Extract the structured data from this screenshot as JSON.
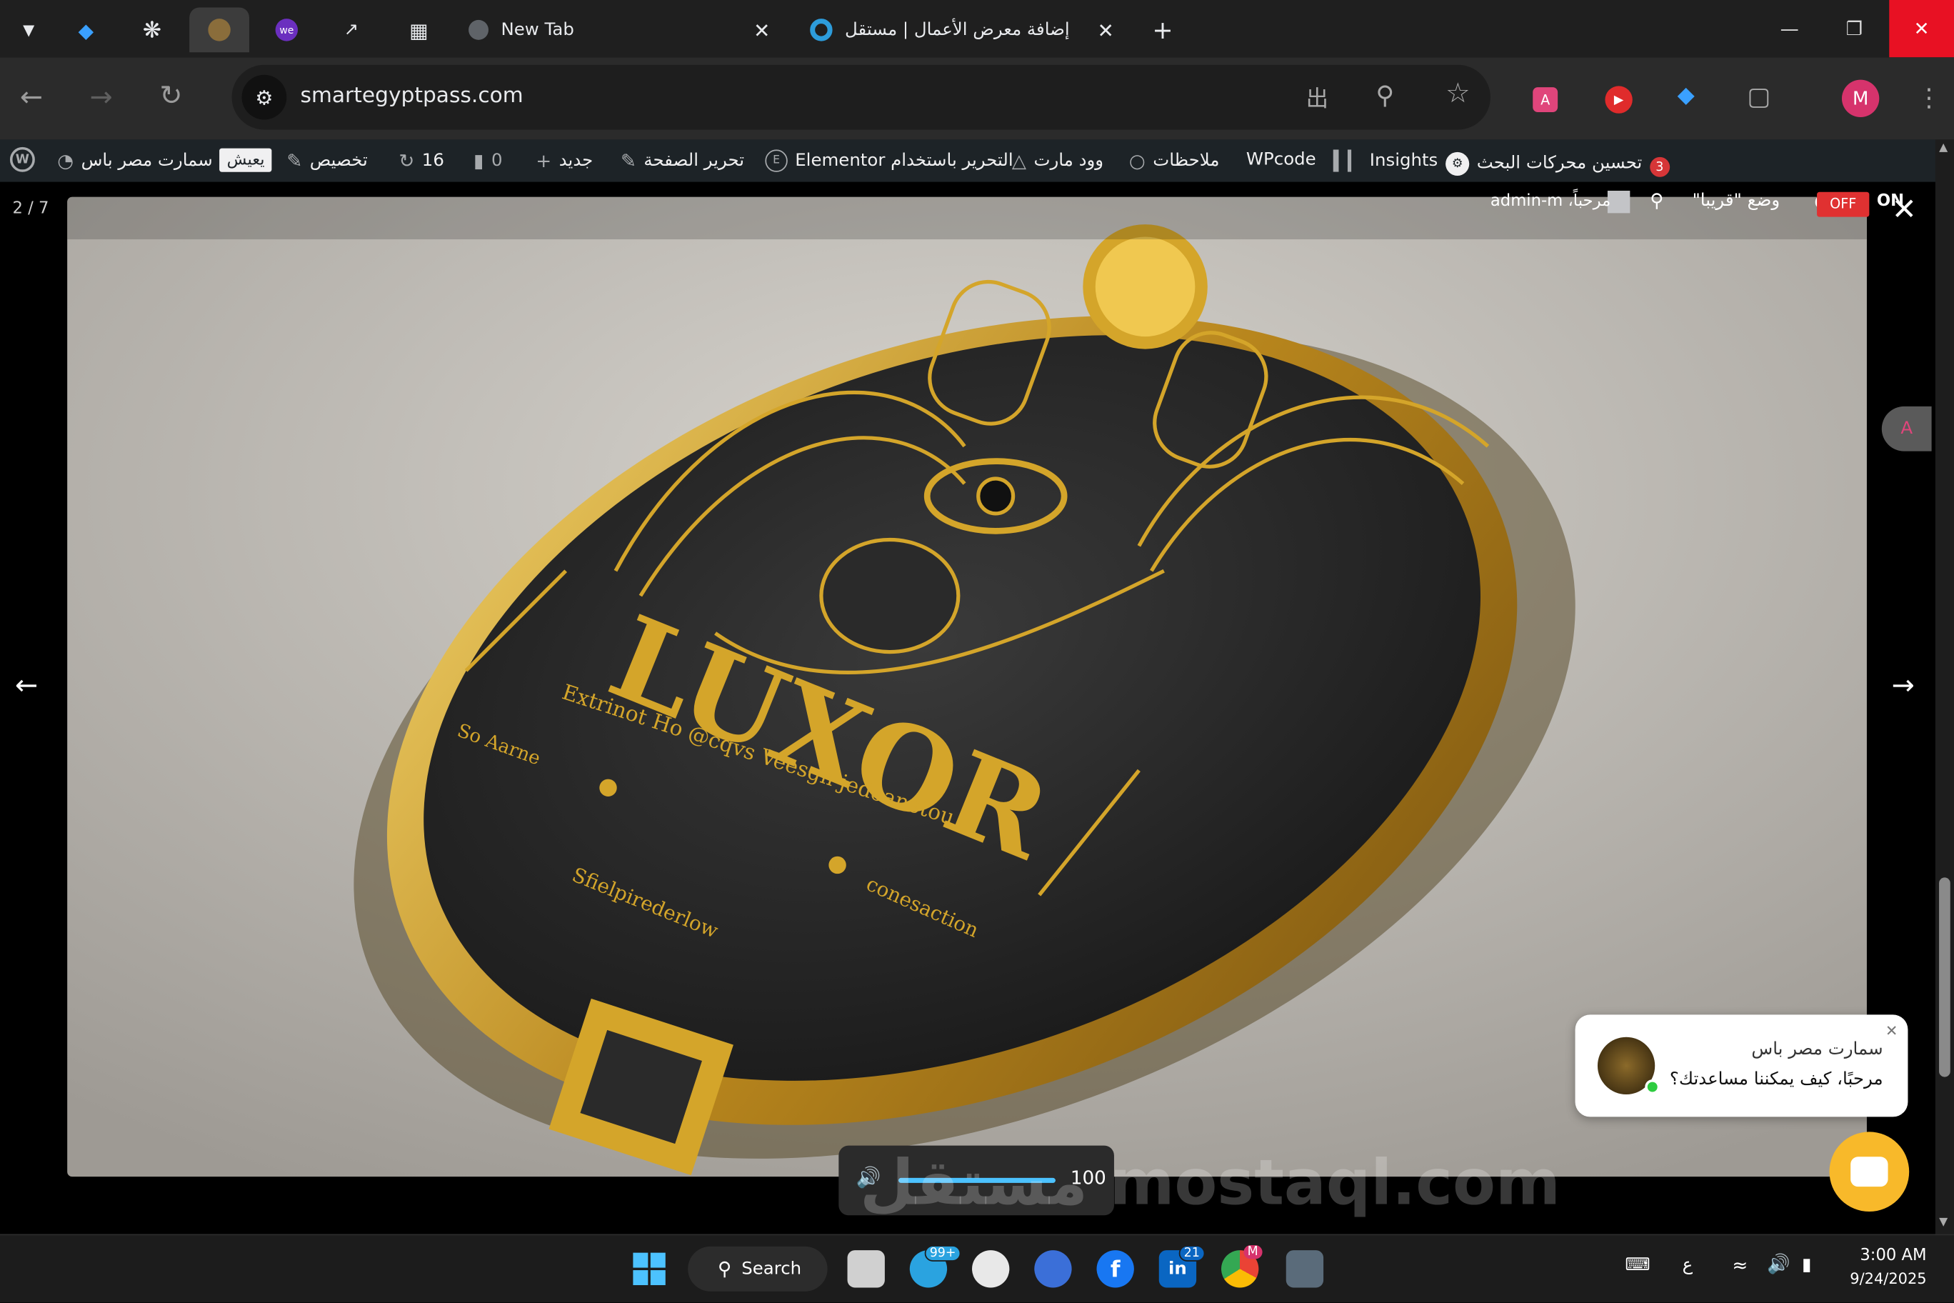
{
  "tabs": [
    {
      "label": "New Tab"
    },
    {
      "label": "إضافة معرض الأعمال | مستقل"
    }
  ],
  "address_bar": {
    "url": "smartegyptpass.com"
  },
  "wp_admin_bar": {
    "site_name": "سمارت مصر باس",
    "live_badge": "يعيش",
    "customize": "تخصيص",
    "updates": "16",
    "comments": "0",
    "new": "جديد",
    "edit_page": "تحرير الصفحة",
    "elementor": "التحرير باستخدام Elementor",
    "woodmart": "وود مارت",
    "notes": "ملاحظات",
    "wpcode": "WPcode",
    "insights": "Insights",
    "seo": "تحسين محركات البحث",
    "seo_count": "3",
    "greeting": "مرحباً، admin-m",
    "maintenance": "وضع \"قريبا\"",
    "off": "OFF",
    "on": "ON"
  },
  "lightbox": {
    "counter": "2 / 7",
    "image": {
      "title_text": "LUXOR",
      "inscription_top": "Extrinot Ho @cqvs Veesgn jedoanetou",
      "inscription_left": "So Aarne",
      "inscription_bottom_left": "Sfielpirederlow",
      "inscription_bottom_right": "conesaction"
    }
  },
  "chat_widget": {
    "name": "سمارت مصر باس",
    "message": "مرحبًا، كيف يمكننا مساعدتك؟"
  },
  "volume": {
    "value": "100",
    "level": 1.0
  },
  "watermark": "مستقل mostaql.com",
  "taskbar": {
    "search_label": "Search",
    "telegram_badge": "99+",
    "linkedin_badge": "21",
    "chrome_badge": "M",
    "language": "ع",
    "time": "3:00 AM",
    "date": "9/24/2025"
  },
  "profile": {
    "initial": "M"
  },
  "colors": {
    "tab_bg": "#1f1f1f",
    "toolbar_bg": "#2b2b2b",
    "wpbar_bg": "#1d2327",
    "accent_red": "#e81123",
    "gold": "#d4a52a",
    "chat_yellow": "#f8b92a"
  }
}
